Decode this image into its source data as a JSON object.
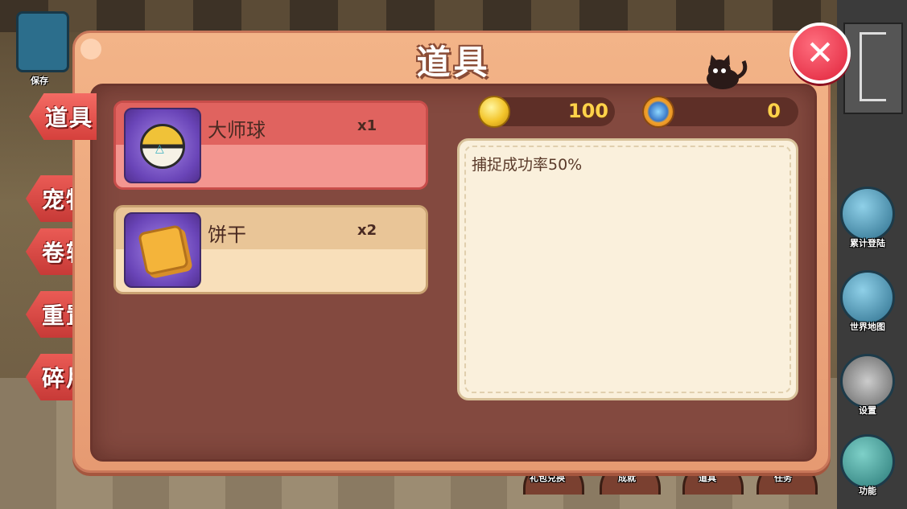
{
  "background": {
    "left_badge_label": "保存",
    "right_menu": [
      {
        "label": "累计登陆",
        "icon": "calendar-icon"
      },
      {
        "label": "世界地图",
        "icon": "world-map-icon"
      },
      {
        "label": "设置",
        "icon": "gear-icon"
      },
      {
        "label": "功能",
        "icon": "function-icon"
      }
    ],
    "bottom_menu": [
      {
        "label": "礼包兑换"
      },
      {
        "label": "成就"
      },
      {
        "label": "道具"
      },
      {
        "label": "任务"
      }
    ]
  },
  "dialog": {
    "title": "道具",
    "close_icon": "✕",
    "tabs": [
      {
        "label": "道具",
        "active": true
      },
      {
        "label": "宠物",
        "active": false
      },
      {
        "label": "卷轴",
        "active": false
      },
      {
        "label": "重置",
        "active": false
      },
      {
        "label": "碎片",
        "active": false
      }
    ],
    "items": [
      {
        "name": "大师球",
        "qty": "x1",
        "icon": "master-ball-icon",
        "selected": true
      },
      {
        "name": "饼干",
        "qty": "x2",
        "icon": "cookie-icon",
        "selected": false
      }
    ],
    "currency": {
      "gold": "100",
      "gem": "0"
    },
    "description": "捕捉成功率50%"
  },
  "colors": {
    "dialog_outer": "#e69a72",
    "dialog_inner": "#83493f",
    "selected_item": "#f39690",
    "normal_item": "#f8dfba",
    "tab_red": "#d5403c",
    "currency_text": "#ffd24a"
  }
}
